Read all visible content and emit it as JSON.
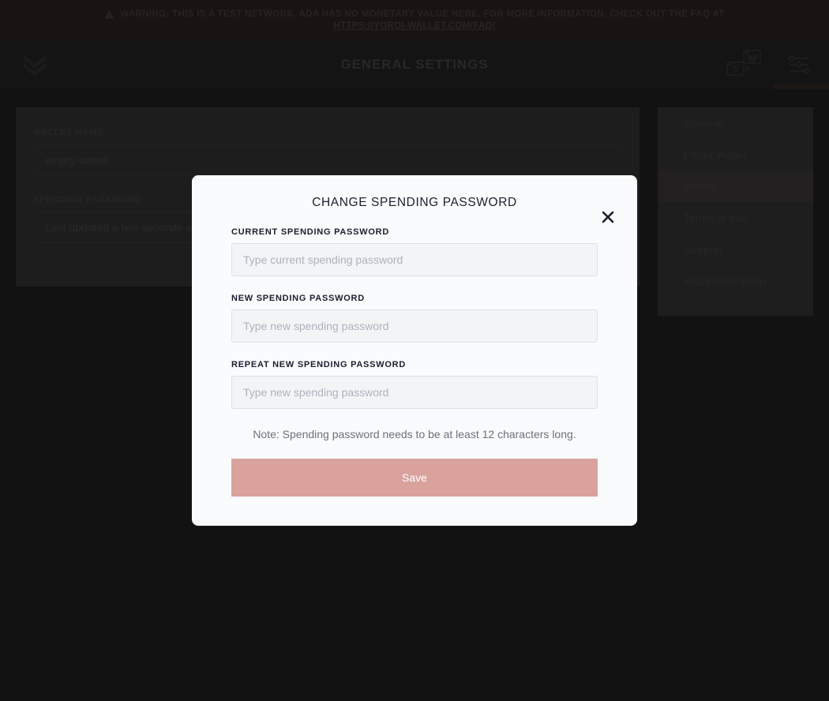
{
  "warning": {
    "icon": "warning-triangle-icon",
    "text": "WARNING: THIS IS A TEST NETWORK. ADA HAS NO MONETARY VALUE HERE. FOR MORE INFORMATION, CHECK OUT THE FAQ AT",
    "link": "HTTPS://YOROI-WALLET.COM/FAQ/",
    "bg_color": "#2b1715"
  },
  "topbar": {
    "logo": "yoroi-logo-icon",
    "title": "GENERAL SETTINGS",
    "actions": [
      {
        "name": "wallet-switcher-icon",
        "label": "Wallet switcher",
        "active": false
      },
      {
        "name": "settings-sliders-icon",
        "label": "Settings",
        "active": true
      }
    ],
    "active_indicator_color": "#33201e",
    "bg_color": "#1a1a1a"
  },
  "settings_form": {
    "wallet_name": {
      "label": "WALLET NAME",
      "value": "empty-wallet"
    },
    "spending_password": {
      "label": "SPENDING PASSWORD",
      "value": "Last updated a few seconds ago"
    }
  },
  "settings_menu": {
    "items": [
      {
        "label": "General",
        "active": false
      },
      {
        "label": "Paper Wallet",
        "active": false
      },
      {
        "label": "Wallet",
        "active": true
      },
      {
        "label": "Terms of use",
        "active": false
      },
      {
        "label": "Support",
        "active": false
      },
      {
        "label": "Ada Redemption",
        "active": false
      }
    ],
    "active_border_color": "#54302d"
  },
  "modal": {
    "title": "CHANGE SPENDING PASSWORD",
    "close_icon": "close-icon",
    "fields": [
      {
        "label": "CURRENT SPENDING PASSWORD",
        "placeholder": "Type current spending password",
        "value": ""
      },
      {
        "label": "NEW SPENDING PASSWORD",
        "placeholder": "Type new spending password",
        "value": ""
      },
      {
        "label": "REPEAT NEW SPENDING PASSWORD",
        "placeholder": "Type new spending password",
        "value": ""
      }
    ],
    "note": "Note: Spending password needs to be at least 12 characters long.",
    "save_label": "Save",
    "save_color": "#d9a29d",
    "bg_color": "#fafbfc"
  }
}
